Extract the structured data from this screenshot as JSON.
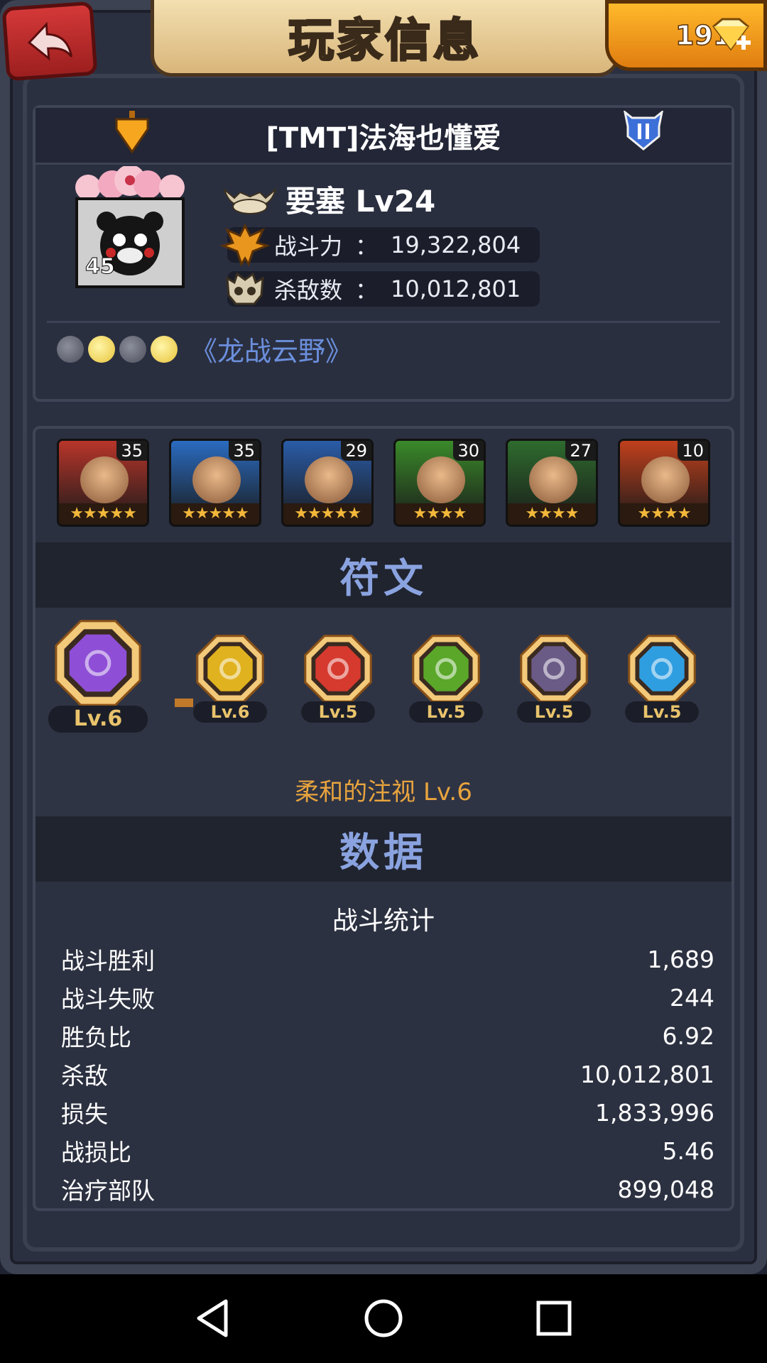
{
  "header": {
    "title": "玩家信息",
    "gems": "191",
    "back_icon": "back-arrow-icon",
    "gem_icon": "diamond-plus-icon"
  },
  "profile": {
    "player_name": "[TMT]法海也懂爱",
    "avatar_level": "45",
    "base_label": "要塞 Lv24",
    "power_label": "战斗力",
    "power_value": "19,322,804",
    "kills_label": "杀敌数",
    "kills_value": "10,012,801",
    "separator": "：",
    "honor_title": "《龙战云野》"
  },
  "heroes": [
    {
      "level": "35",
      "stars": "★★★★★",
      "color": "#b8352a"
    },
    {
      "level": "35",
      "stars": "★★★★★",
      "color": "#2a6bc0"
    },
    {
      "level": "29",
      "stars": "★★★★★",
      "color": "#2a5ca8"
    },
    {
      "level": "30",
      "stars": "★★★★",
      "color": "#3a8a2a"
    },
    {
      "level": "27",
      "stars": "★★★★",
      "color": "#2e6b2e"
    },
    {
      "level": "10",
      "stars": "★★★★",
      "color": "#c0401c"
    }
  ],
  "runes": {
    "section_title": "符文",
    "items": [
      {
        "level": "Lv.6",
        "color": "#8e4fd6",
        "icon": "spiral-rune-icon"
      },
      {
        "level": "Lv.6",
        "color": "#e0b21f",
        "icon": "diamond-rune-icon"
      },
      {
        "level": "Lv.5",
        "color": "#d6392e",
        "icon": "cross-rune-icon"
      },
      {
        "level": "Lv.5",
        "color": "#5aa72a",
        "icon": "leaf-rune-icon"
      },
      {
        "level": "Lv.5",
        "color": "#6a5a86",
        "icon": "bars-rune-icon"
      },
      {
        "level": "Lv.5",
        "color": "#2f9ee0",
        "icon": "anchor-rune-icon"
      }
    ],
    "selected_name": "柔和的注视 Lv.6"
  },
  "data": {
    "section_title": "数据",
    "stats_title": "战斗统计",
    "rows": [
      {
        "label": "战斗胜利",
        "value": "1,689"
      },
      {
        "label": "战斗失败",
        "value": "244"
      },
      {
        "label": "胜负比",
        "value": "6.92"
      },
      {
        "label": "杀敌",
        "value": "10,012,801"
      },
      {
        "label": "损失",
        "value": "1,833,996"
      },
      {
        "label": "战损比",
        "value": "5.46"
      },
      {
        "label": "治疗部队",
        "value": "899,048"
      }
    ]
  }
}
